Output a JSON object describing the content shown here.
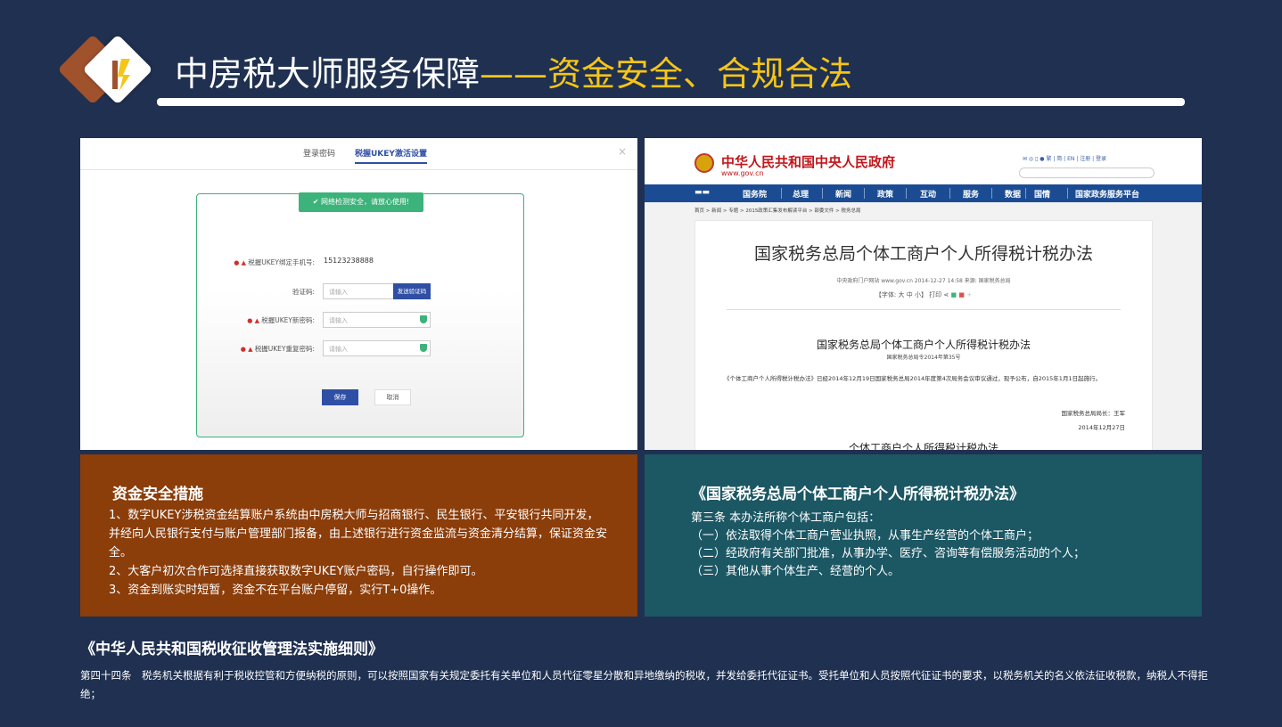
{
  "colors": {
    "background": "#1f3050",
    "highlight": "#f5c518",
    "panel_left": "#8b3d0a",
    "panel_right": "#1c5764"
  },
  "header": {
    "title_main": "中房税大师服务保障",
    "title_highlight": "——资金安全、合规合法"
  },
  "login_screenshot": {
    "tab_password": "登录密码",
    "tab_ukey": "税握UKEY激活设置",
    "close": "×",
    "notice": "网络检测安全，请放心使用!",
    "phone_label": "税握UKEY绑定手机号:",
    "phone_value": "15123238888",
    "code_label": "验证码:",
    "code_placeholder": "请输入",
    "send_code": "发送验证码",
    "new_pwd_label": "税握UKEY新密码:",
    "new_pwd_placeholder": "请输入",
    "repeat_pwd_label": "税握UKEY重复密码:",
    "repeat_pwd_placeholder": "请输入",
    "save": "保存",
    "cancel": "取消"
  },
  "gov_screenshot": {
    "site_name": "中华人民共和国中央人民政府",
    "site_url": "www.gov.cn",
    "tools": "繁 | 简 | EN | 注册 | 登录",
    "nav": [
      "国务院",
      "总理",
      "新闻",
      "政策",
      "互动",
      "服务",
      "数据",
      "国情",
      "国家政务服务平台"
    ],
    "breadcrumb": "首页 > 新闻 > 专题 > 2015政策汇集发布解读平台 > 部委文件 > 税务总局",
    "article_title": "国家税务总局个体工商户个人所得税计税办法",
    "meta": "中央政府门户网站 www.gov.cn 2014-12-27 14:58 来源: 国家税务总局",
    "font_tools": "【字体: 大 中 小】 打印",
    "heading": "国家税务总局个体工商户个人所得税计税办法",
    "order": "国家税务总局令2014年第35号",
    "paragraph": "《个体工商户个人所得税计税办法》已经2014年12月19日国家税务总局2014年度第4次局务会议审议通过，现予公布，自2015年1月1日起施行。",
    "signer": "国家税务总局局长：王军",
    "date": "2014年12月27日",
    "next_heading": "个体工商户个人所得税计税办法"
  },
  "security": {
    "title": "资金安全措施",
    "lines": [
      "1、数字UKEY涉税资金结算账户系统由中房税大师与招商银行、民生银行、平安银行共同开发，并经向人民银行支付与账户管理部门报备，由上述银行进行资金监流与资金清分结算，保证资金安全。",
      "2、大客户初次合作可选择直接获取数字UKEY账户密码，自行操作即可。",
      "3、资金到账实时短暂，资金不在平台账户停留，实行T+0操作。"
    ]
  },
  "tax_method": {
    "title": "《国家税务总局个体工商户个人所得税计税办法》",
    "lines": [
      "第三条 本办法所称个体工商户包括：",
      "（一）依法取得个体工商户营业执照，从事生产经营的个体工商户；",
      "（二）经政府有关部门批准，从事办学、医疗、咨询等有偿服务活动的个人；",
      "（三）其他从事个体生产、经营的个人。"
    ]
  },
  "tax_law": {
    "title": "《中华人民共和国税收征收管理法实施细则》",
    "body": "第四十四条　税务机关根据有利于税收控管和方便纳税的原则，可以按照国家有关规定委托有关单位和人员代征零星分散和异地缴纳的税收，并发给委托代征证书。受托单位和人员按照代征证书的要求，以税务机关的名义依法征收税款，纳税人不得拒绝；"
  }
}
